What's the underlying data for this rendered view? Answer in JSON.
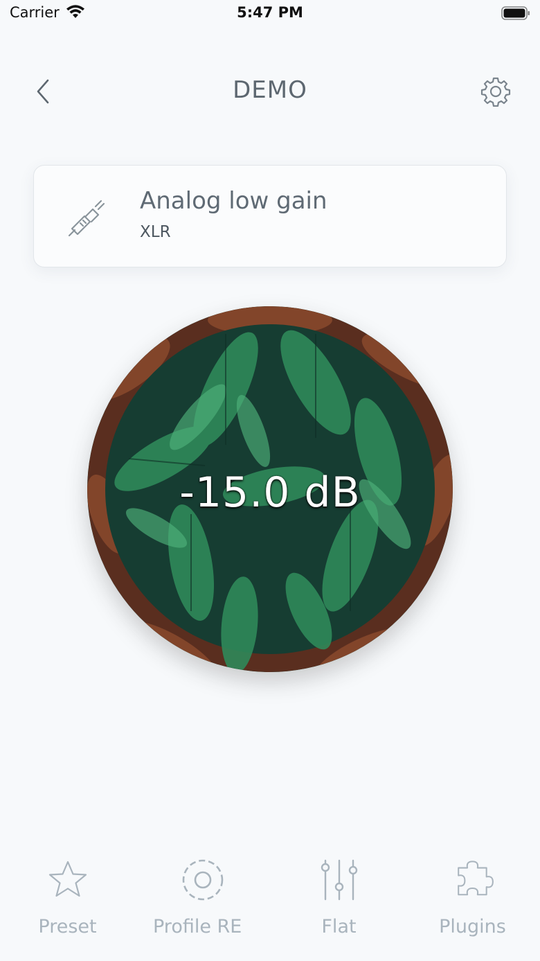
{
  "status_bar": {
    "carrier": "Carrier",
    "time": "5:47 PM",
    "wifi_icon": "wifi-icon",
    "battery_icon": "battery-icon"
  },
  "nav": {
    "title": "DEMO",
    "back_icon": "chevron-left-icon",
    "settings_icon": "gear-icon"
  },
  "input": {
    "icon": "cable-plug-icon",
    "title": "Analog low gain",
    "subtitle": "XLR"
  },
  "volume": {
    "value": "-15.0 dB"
  },
  "tabs": [
    {
      "label": "Preset",
      "icon": "star-icon"
    },
    {
      "label": "Profile RE",
      "icon": "target-icon"
    },
    {
      "label": "Flat",
      "icon": "sliders-icon"
    },
    {
      "label": "Plugins",
      "icon": "puzzle-icon"
    }
  ],
  "colors": {
    "background": "#f7f9fb",
    "text": "#5f6a74",
    "tab_inactive": "#a9b4bd",
    "dial_green": "#1d4a3c",
    "dial_rim": "#6b3a26"
  }
}
